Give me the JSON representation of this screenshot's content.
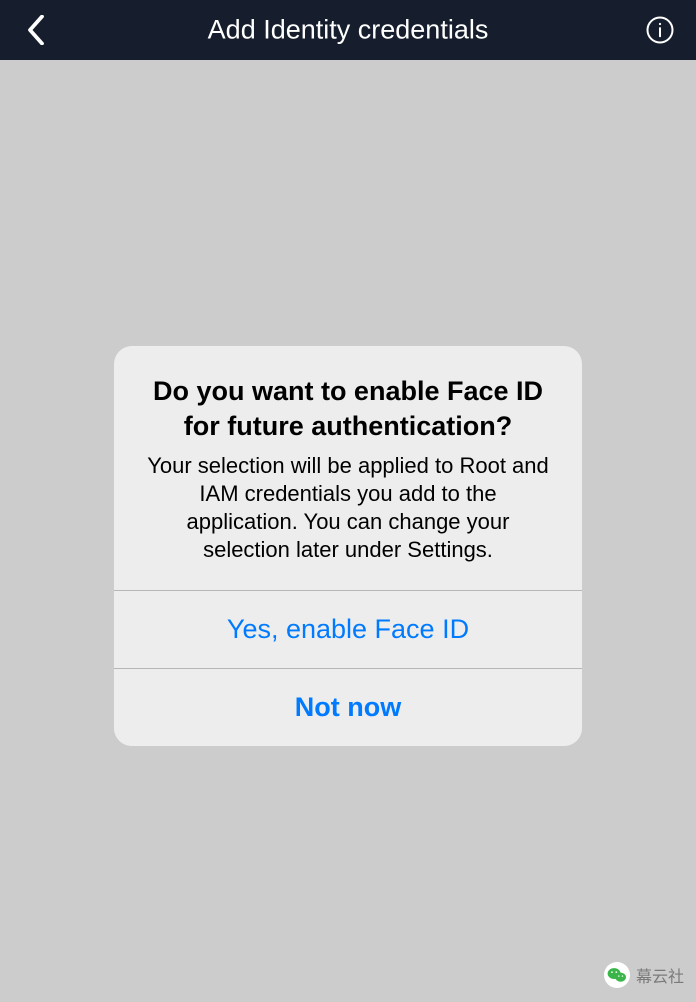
{
  "header": {
    "title": "Add Identity credentials"
  },
  "alert": {
    "title": "Do you want to enable Face ID for future authentication?",
    "message": "Your selection will be applied to Root and IAM credentials you add to the application. You can change your selection later under Settings.",
    "primary_label": "Yes, enable Face ID",
    "secondary_label": "Not now"
  },
  "watermark": {
    "text": "幕云社"
  }
}
